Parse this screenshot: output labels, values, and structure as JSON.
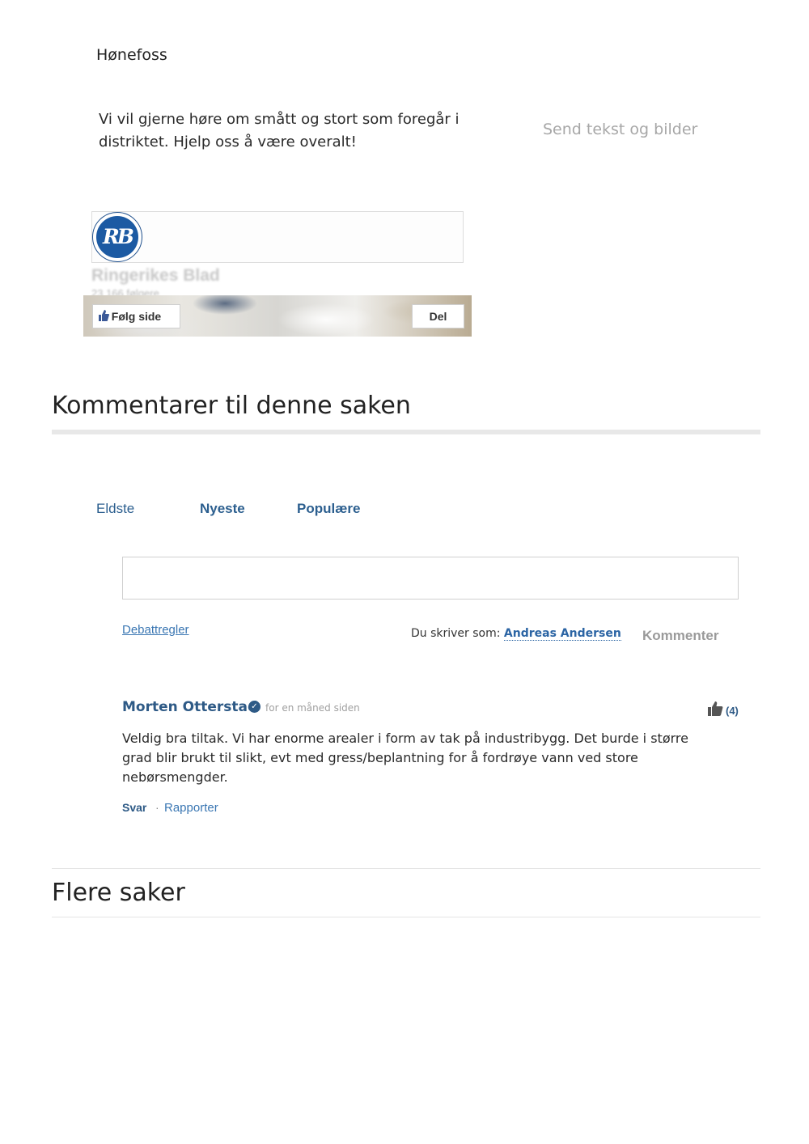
{
  "location": "Hønefoss",
  "intro": {
    "text": "Vi vil gjerne høre om smått og stort som foregår i distriktet. Hjelp oss å være overalt!",
    "send_link": "Send tekst og bilder"
  },
  "facebook_plugin": {
    "logo_text": "RB",
    "page_name": "Ringerikes Blad",
    "followers": "23 166 følgere",
    "follow_button": "Følg side",
    "share_button": "Del"
  },
  "comments": {
    "heading": "Kommentarer til denne saken",
    "sort_tabs": [
      "Eldste",
      "Nyeste",
      "Populære"
    ],
    "rules_link": "Debattregler",
    "writing_as_label": "Du skriver som:",
    "writing_as_user": "Andreas Andersen",
    "submit_button": "Kommenter",
    "items": [
      {
        "author": "Morten Otterstad",
        "verified": true,
        "time": "for en måned siden",
        "likes": "(4)",
        "body": "Veldig bra tiltak. Vi har enorme arealer i form av tak på industribygg. Det burde i større grad blir brukt til slikt, evt med gress/beplantning for å fordrøye vann ved store nebørsmengder.",
        "reply": "Svar",
        "report": "Rapporter"
      }
    ]
  },
  "more_articles": {
    "heading": "Flere saker"
  },
  "colors": {
    "link_blue": "#2e5a86",
    "accent_blue": "#3b77b3",
    "muted_gray": "#a7a7a7"
  },
  "icons": [
    "verified-check-icon",
    "thumbs-up-icon",
    "facebook-like-icon"
  ]
}
